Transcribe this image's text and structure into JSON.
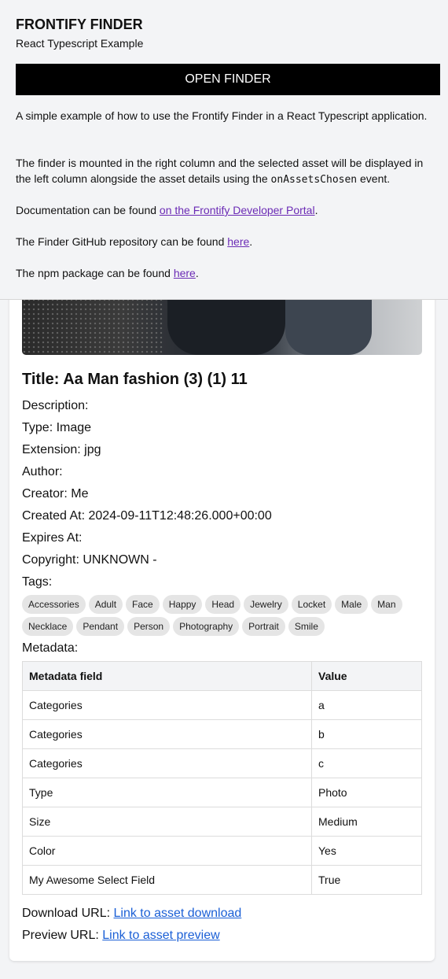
{
  "header": {
    "title": "FRONTIFY FINDER",
    "subtitle": "React Typescript Example",
    "open_button": "OPEN FINDER",
    "p1": "A simple example of how to use the Frontify Finder in a React Typescript application.",
    "p2_before": "The finder is mounted in the right column and the selected asset will be displayed in the left column alongside the asset details using the ",
    "p2_code": "onAssetsChosen",
    "p2_after": " event.",
    "p3_before": "Documentation can be found ",
    "p3_link": "on the Frontify Developer Portal",
    "p3_after": ".",
    "p4_before": "The Finder GitHub repository can be found ",
    "p4_link": "here",
    "p4_after": ".",
    "p5_before": "The npm package can be found ",
    "p5_link": "here",
    "p5_after": "."
  },
  "asset": {
    "title": "Title: Aa Man fashion (3) (1) 11",
    "description": "Description:",
    "type": "Type: Image",
    "extension": "Extension: jpg",
    "author": "Author:",
    "creator": "Creator: Me",
    "created_at": "Created At: 2024-09-11T12:48:26.000+00:00",
    "expires_at": "Expires At:",
    "copyright": "Copyright: UNKNOWN -",
    "tags_label": "Tags:",
    "tags": [
      "Accessories",
      "Adult",
      "Face",
      "Happy",
      "Head",
      "Jewelry",
      "Locket",
      "Male",
      "Man",
      "Necklace",
      "Pendant",
      "Person",
      "Photography",
      "Portrait",
      "Smile"
    ],
    "metadata_label": "Metadata:",
    "metadata_headers": [
      "Metadata field",
      "Value"
    ],
    "metadata_rows": [
      [
        "Categories",
        "a"
      ],
      [
        "Categories",
        "b"
      ],
      [
        "Categories",
        "c"
      ],
      [
        "Type",
        "Photo"
      ],
      [
        "Size",
        "Medium"
      ],
      [
        "Color",
        "Yes"
      ],
      [
        "My Awesome Select Field",
        "True"
      ]
    ],
    "download_label": "Download URL: ",
    "download_link": "Link to asset download",
    "preview_label": "Preview URL: ",
    "preview_link": "Link to asset preview"
  }
}
